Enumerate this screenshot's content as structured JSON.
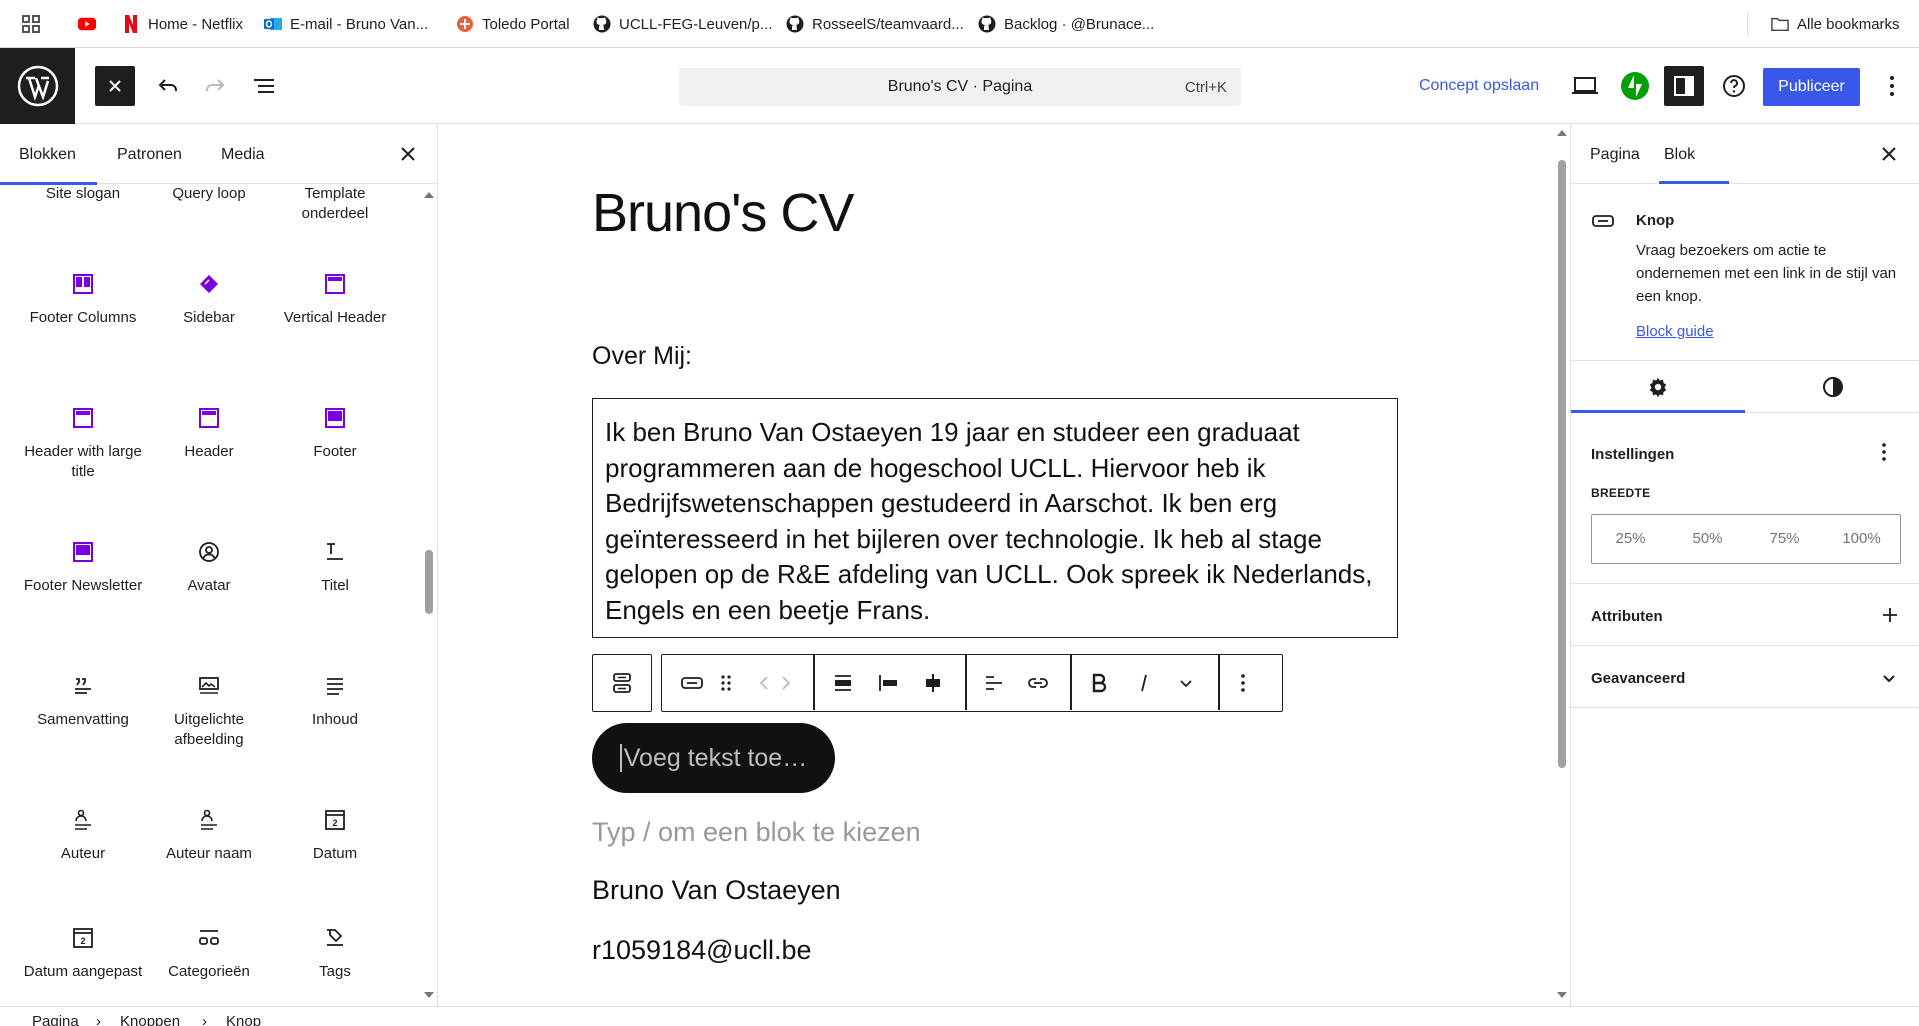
{
  "bookmarks": {
    "items": [
      {
        "label": "Home - Netflix"
      },
      {
        "label": "E-mail - Bruno Van..."
      },
      {
        "label": "Toledo Portal"
      },
      {
        "label": "UCLL-FEG-Leuven/p..."
      },
      {
        "label": "RosseelS/teamvaard..."
      },
      {
        "label": "Backlog · @Brunace..."
      }
    ],
    "all_bookmarks": "Alle bookmarks"
  },
  "header": {
    "command_title": "Bruno's CV · Pagina",
    "shortcut": "Ctrl+K",
    "save_draft": "Concept opslaan",
    "publish": "Publiceer",
    "brand_color": "#3858e9"
  },
  "inserter": {
    "tabs": [
      "Blokken",
      "Patronen",
      "Media"
    ],
    "blocks": [
      {
        "label": "Site slogan",
        "icon": "site-tagline-icon"
      },
      {
        "label": "Query loop",
        "icon": "query-loop-icon"
      },
      {
        "label": "Template onderdeel",
        "icon": "template-part-icon"
      },
      {
        "label": "Footer Columns",
        "icon": "footer-layout-icon"
      },
      {
        "label": "Sidebar",
        "icon": "sidebar-diamond-icon"
      },
      {
        "label": "Vertical Header",
        "icon": "header-layout-icon"
      },
      {
        "label": "Header with large title",
        "icon": "header-layout-icon"
      },
      {
        "label": "Header",
        "icon": "header-layout-icon"
      },
      {
        "label": "Footer",
        "icon": "footer-layout-icon"
      },
      {
        "label": "Footer Newsletter",
        "icon": "footer-layout-icon"
      },
      {
        "label": "Avatar",
        "icon": "avatar-icon"
      },
      {
        "label": "Titel",
        "icon": "title-icon"
      },
      {
        "label": "Samenvatting",
        "icon": "excerpt-icon"
      },
      {
        "label": "Uitgelichte afbeelding",
        "icon": "featured-image-icon"
      },
      {
        "label": "Inhoud",
        "icon": "content-icon"
      },
      {
        "label": "Auteur",
        "icon": "author-icon"
      },
      {
        "label": "Auteur naam",
        "icon": "author-name-icon"
      },
      {
        "label": "Datum",
        "icon": "date-icon"
      },
      {
        "label": "Datum aangepast",
        "icon": "date-modified-icon"
      },
      {
        "label": "Categorieën",
        "icon": "categories-icon"
      },
      {
        "label": "Tags",
        "icon": "tags-icon"
      }
    ]
  },
  "canvas": {
    "title": "Bruno's CV",
    "heading": "Over Mij:",
    "paragraph": "Ik ben Bruno Van Ostaeyen 19 jaar en studeer een graduaat programmeren aan de hogeschool UCLL. Hiervoor heb ik Bedrijfswetenschappen gestudeerd in Aarschot. Ik ben erg geïnteresseerd in het bijleren over technologie. Ik heb al stage gelopen op de R&E afdeling van UCLL. Ook spreek ik Nederlands, Engels en een beetje Frans.",
    "button_placeholder": "Voeg tekst toe…",
    "block_placeholder": "Typ / om een blok te kiezen",
    "name": "Bruno Van Ostaeyen",
    "email": "r1059184@ucll.be"
  },
  "sidebar": {
    "tabs": [
      "Pagina",
      "Blok"
    ],
    "block_name": "Knop",
    "block_description": "Vraag bezoekers om actie te ondernemen met een link in de stijl van een knop.",
    "block_guide": "Block guide",
    "settings": "Instellingen",
    "width_label": "BREEDTE",
    "width_options": [
      "25%",
      "50%",
      "75%",
      "100%"
    ],
    "attributes": "Attributen",
    "advanced": "Geavanceerd"
  },
  "breadcrumb": [
    "Pagina",
    "Knoppen",
    "Knop"
  ]
}
